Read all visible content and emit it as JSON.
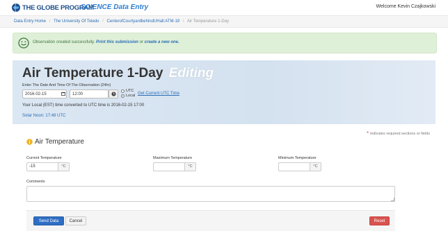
{
  "header": {
    "logo_text": "THE GLOBE PROGRAM",
    "app_title": "SCIENCE Data Entry",
    "welcome": "Welcome Kevin Czajkowski"
  },
  "breadcrumb": {
    "items": [
      "Data Entry Home",
      "The University Of Toledo",
      "CenterofCourtyardbehindUHall:ATM-19"
    ],
    "current": "Air Temperature 1-Day",
    "separator": "/"
  },
  "alert": {
    "text": "Observation created successfully.",
    "print_link": "Print this submission",
    "or": "or",
    "create_link": "create a new one."
  },
  "observation": {
    "title": "Air Temperature 1-Day",
    "mode": "Editing",
    "instruction": "Enter The Date And Time Of The Observation (24hr)",
    "date": "2016-02-15",
    "time": "12:00",
    "utc_label": "UTC",
    "local_label": "Local",
    "selected_zone": "Local",
    "utc_link": "Get Current UTC Time",
    "converted": "Your Local (EST) time converted to UTC time is 2016-02-15 17:00",
    "solar_noon": "Solar Noon: 17:48 UTC"
  },
  "form": {
    "required_note": "indicates required sections or fields",
    "section_title": "Air Temperature",
    "current_label": "Current Temperature",
    "current_value": "-15",
    "max_label": "Maximum Temperature",
    "max_value": "",
    "min_label": "Minimum Temperature",
    "min_value": "",
    "unit": "°C",
    "comments_label": "Comments",
    "comments_value": ""
  },
  "buttons": {
    "send": "Send Data",
    "cancel": "Cancel",
    "reset": "Reset"
  },
  "colors": {
    "brand_blue": "#2e7fd0",
    "success_bg": "#dff0d8",
    "danger": "#d9534f",
    "primary": "#2e6ec4"
  }
}
